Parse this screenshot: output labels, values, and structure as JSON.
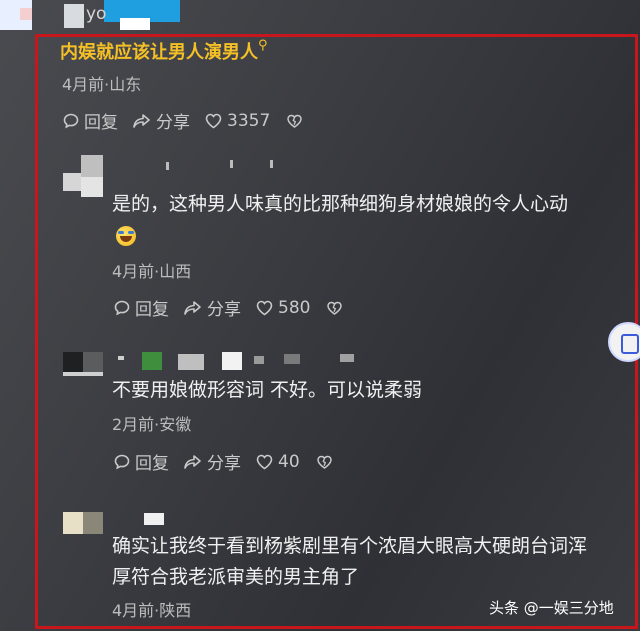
{
  "top_fragment": "yo",
  "comments": [
    {
      "text": "内娱就应该让男人演男人",
      "meta": "4月前·山东",
      "reply": "回复",
      "share": "分享",
      "likes": "3357"
    },
    {
      "text": "是的，这种男人味真的比那种细狗身材娘娘的令人心动",
      "meta": "4月前·山西",
      "reply": "回复",
      "share": "分享",
      "likes": "580"
    },
    {
      "text": "不要用娘做形容词 不好。可以说柔弱",
      "meta": "2月前·安徽",
      "reply": "回复",
      "share": "分享",
      "likes": "40"
    },
    {
      "text_line1": "确实让我终于看到杨紫剧里有个浓眉大眼高大硬朗台词浑",
      "text_line2": "厚符合我老派审美的男主角了",
      "meta": "4月前·陕西"
    }
  ],
  "watermark": "头条 @一娱三分地",
  "colors": {
    "highlight_border": "#c8161d",
    "title_text": "#f4c026"
  },
  "icons": [
    "comment-bubble-icon",
    "share-arrow-icon",
    "heart-icon",
    "broken-heart-icon",
    "search-icon"
  ]
}
